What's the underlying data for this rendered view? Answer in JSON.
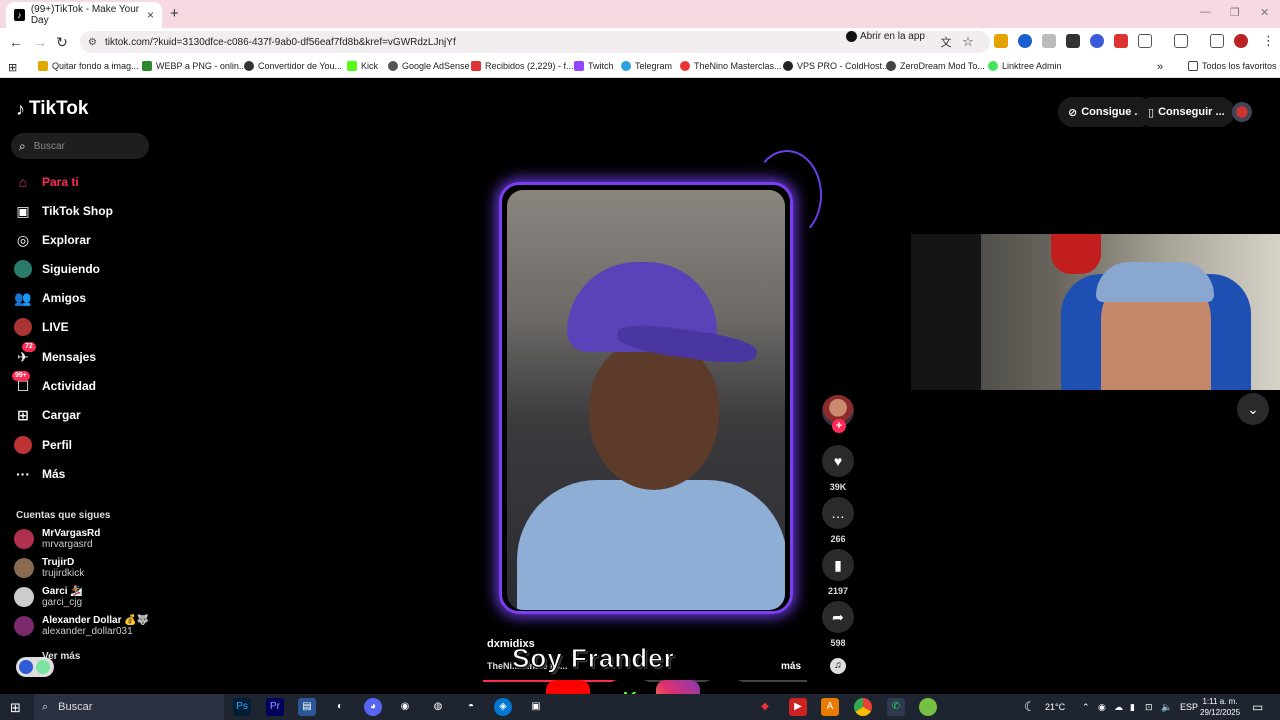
{
  "browser": {
    "tab_title": "(99+)TikTok - Make Your Day",
    "tab_close": "×",
    "new_tab": "+",
    "url": "tiktok.com/?kuid=3130dfce-c086-437f-9ab0-df56eaf7fd8b&kref=vGWRdzLJnjYf",
    "open_in_app": "Abrir en la app",
    "bookmarks": [
      "Quitar fondo a imag...",
      "WEBP a PNG - onlin...",
      "Convertidor de You...",
      "Kick",
      "Google AdSense",
      "Recibidos (2,229) - f...",
      "Twitch",
      "Telegram",
      "TheNino Masterclas...",
      "VPS PRO - ColdHost...",
      "ZeroDream Mod To...",
      "Linktree Admin"
    ],
    "bookmarks_more": "»",
    "all_bookmarks": "Todos los favoritos"
  },
  "tiktok": {
    "logo": "TikTok",
    "search_placeholder": "Buscar",
    "nav": [
      {
        "label": "Para ti",
        "icon": "home-icon"
      },
      {
        "label": "TikTok Shop",
        "icon": "shop-icon"
      },
      {
        "label": "Explorar",
        "icon": "compass-icon"
      },
      {
        "label": "Siguiendo",
        "icon": "following-avatar"
      },
      {
        "label": "Amigos",
        "icon": "friends-icon"
      },
      {
        "label": "LIVE",
        "icon": "live-avatar"
      },
      {
        "label": "Mensajes",
        "icon": "messages-icon",
        "badge": "72"
      },
      {
        "label": "Actividad",
        "icon": "activity-icon",
        "badge": "99+"
      },
      {
        "label": "Cargar",
        "icon": "upload-icon"
      },
      {
        "label": "Perfil",
        "icon": "profile-avatar"
      },
      {
        "label": "Más",
        "icon": "more-icon"
      }
    ],
    "following_title": "Cuentas que sigues",
    "accounts": [
      {
        "name": "MrVargasRd",
        "handle": "mrvargasrd",
        "color": "#b03050"
      },
      {
        "name": "TrujirD",
        "handle": "trujirdkick",
        "color": "#8a6a50"
      },
      {
        "name": "Garci 🏂",
        "handle": "garci_cjg",
        "color": "#cccccc"
      },
      {
        "name": "Alexander Dollar 💰🐺",
        "handle": "alexander_dollar031",
        "color": "#7a2a6a"
      }
    ],
    "see_more": "Ver más",
    "header_buttons": [
      "Consigue ...",
      "Conseguir ..."
    ],
    "video": {
      "username": "dxmidixs",
      "description": "TheNi... ...na e #c...",
      "more": "más",
      "overlay_text": "Soy Frander",
      "progress": 0.42
    },
    "actions": {
      "likes": "39K",
      "comments": "266",
      "saves": "2197",
      "shares": "598"
    }
  },
  "taskbar": {
    "search": "Buscar",
    "temperature": "21°C",
    "language": "ESP",
    "time": "1:11 a. m.",
    "date": "29/12/2025"
  },
  "colors": {
    "accent": "#fe2c55",
    "glow": "#7b3ef0",
    "tab_strip": "#f6d9e1"
  }
}
